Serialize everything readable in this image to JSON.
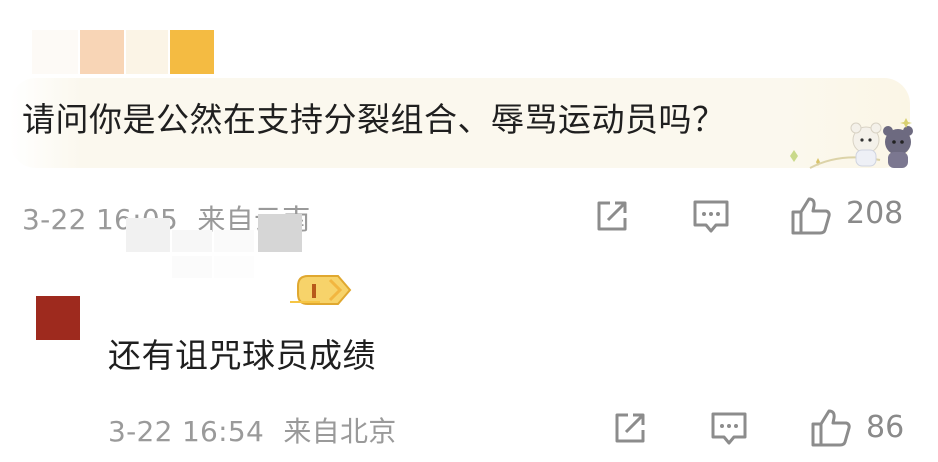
{
  "comments": [
    {
      "text": "请问你是公然在支持分裂组合、辱骂运动员吗？",
      "time": "3-22 16:05",
      "location": "来自云南",
      "likes": "208"
    },
    {
      "text": "还有诅咒球员成绩",
      "time": "3-22 16:54",
      "location": "来自北京",
      "likes": "86"
    }
  ],
  "icons": {
    "share": "share-icon",
    "reply": "comment-icon",
    "like": "thumb-up-icon",
    "badge": "level-badge-icon",
    "decoration": "bear-sticker-icon"
  },
  "colors": {
    "avatar2": "#9e2a1e",
    "badge_gold": "#f6c544",
    "meta_gray": "#9a9a9a"
  }
}
